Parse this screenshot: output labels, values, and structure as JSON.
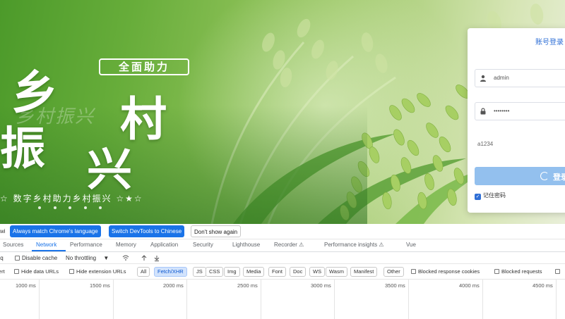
{
  "banner": {
    "slogan_badge": "全面助力",
    "big_chars": [
      "乡",
      "村",
      "振",
      "兴"
    ],
    "ghost_text": "乡村振兴",
    "tagline": "☆ 数字乡村助力乡村振兴 ☆★☆"
  },
  "login": {
    "title": "账号登录",
    "username_value": "admin",
    "password_value": "••••••••",
    "captcha_value": "a1234",
    "login_label": "登录",
    "remember_label": "记住密码"
  },
  "devtools": {
    "infobar": {
      "left_fragment": "wi",
      "always_match": "Always match Chrome's language",
      "switch": "Switch DevTools to Chinese",
      "dont_show": "Don't show again"
    },
    "tabs": [
      "Sources",
      "Network",
      "Performance",
      "Memory",
      "Application",
      "Security",
      "Lighthouse",
      "Recorder ⚠",
      "Performance insights ⚠",
      "Vue"
    ],
    "active_tab": "Network",
    "toolbar": {
      "left_fragment": "Iq",
      "disable_cache": "Disable cache",
      "throttling": "No throttling"
    },
    "filters": {
      "left_fragment": "nvert",
      "hide_data_urls": "Hide data URLs",
      "hide_extension_urls": "Hide extension URLs",
      "types": [
        "All",
        "Fetch/XHR",
        "JS",
        "CSS",
        "Img",
        "Media",
        "Font",
        "Doc",
        "WS",
        "Wasm",
        "Manifest",
        "Other"
      ],
      "active_type": "Fetch/XHR",
      "blocked_cookies": "Blocked response cookies",
      "blocked_requests": "Blocked requests"
    },
    "timeline_ticks": [
      "1000 ms",
      "1500 ms",
      "2000 ms",
      "2500 ms",
      "3000 ms",
      "3500 ms",
      "4000 ms",
      "4500 ms"
    ]
  }
}
